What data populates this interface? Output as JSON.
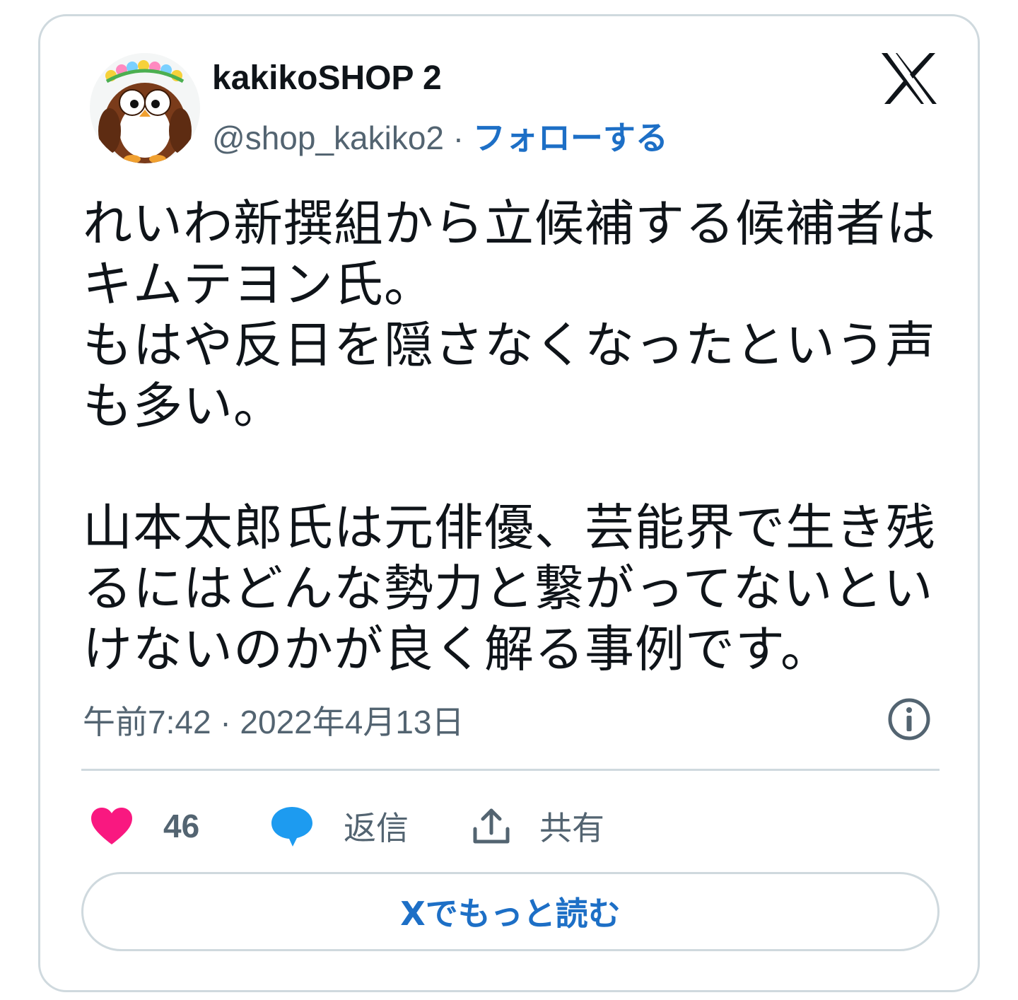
{
  "author": {
    "display_name": "kakikoSHOP 2",
    "handle": "@shop_kakiko2",
    "separator": "·",
    "follow_label": "フォローする"
  },
  "tweet": {
    "text": "れいわ新撰組から立候補する候補者は\nキムテヨン氏。\nもはや反日を隠さなくなったという声\nも多い。\n\n山本太郎氏は元俳優、芸能界で生き残\nるにはどんな勢力と繋がってないとい\nけないのかが良く解る事例です。",
    "time": "午前7:42",
    "separator": "·",
    "date": "2022年4月13日"
  },
  "actions": {
    "like_count": "46",
    "reply_label": "返信",
    "share_label": "共有"
  },
  "read_more_label": "Xでもっと読む",
  "icons": {
    "platform": "x-logo-icon",
    "info": "info-icon",
    "like": "heart-icon",
    "reply": "speech-bubble-icon",
    "share": "share-upload-icon"
  },
  "colors": {
    "text": "#0f1419",
    "secondary": "#536471",
    "link": "#1d6fc6",
    "heart": "#f91880",
    "reply": "#1d9bf0",
    "border": "#cfd9de"
  }
}
